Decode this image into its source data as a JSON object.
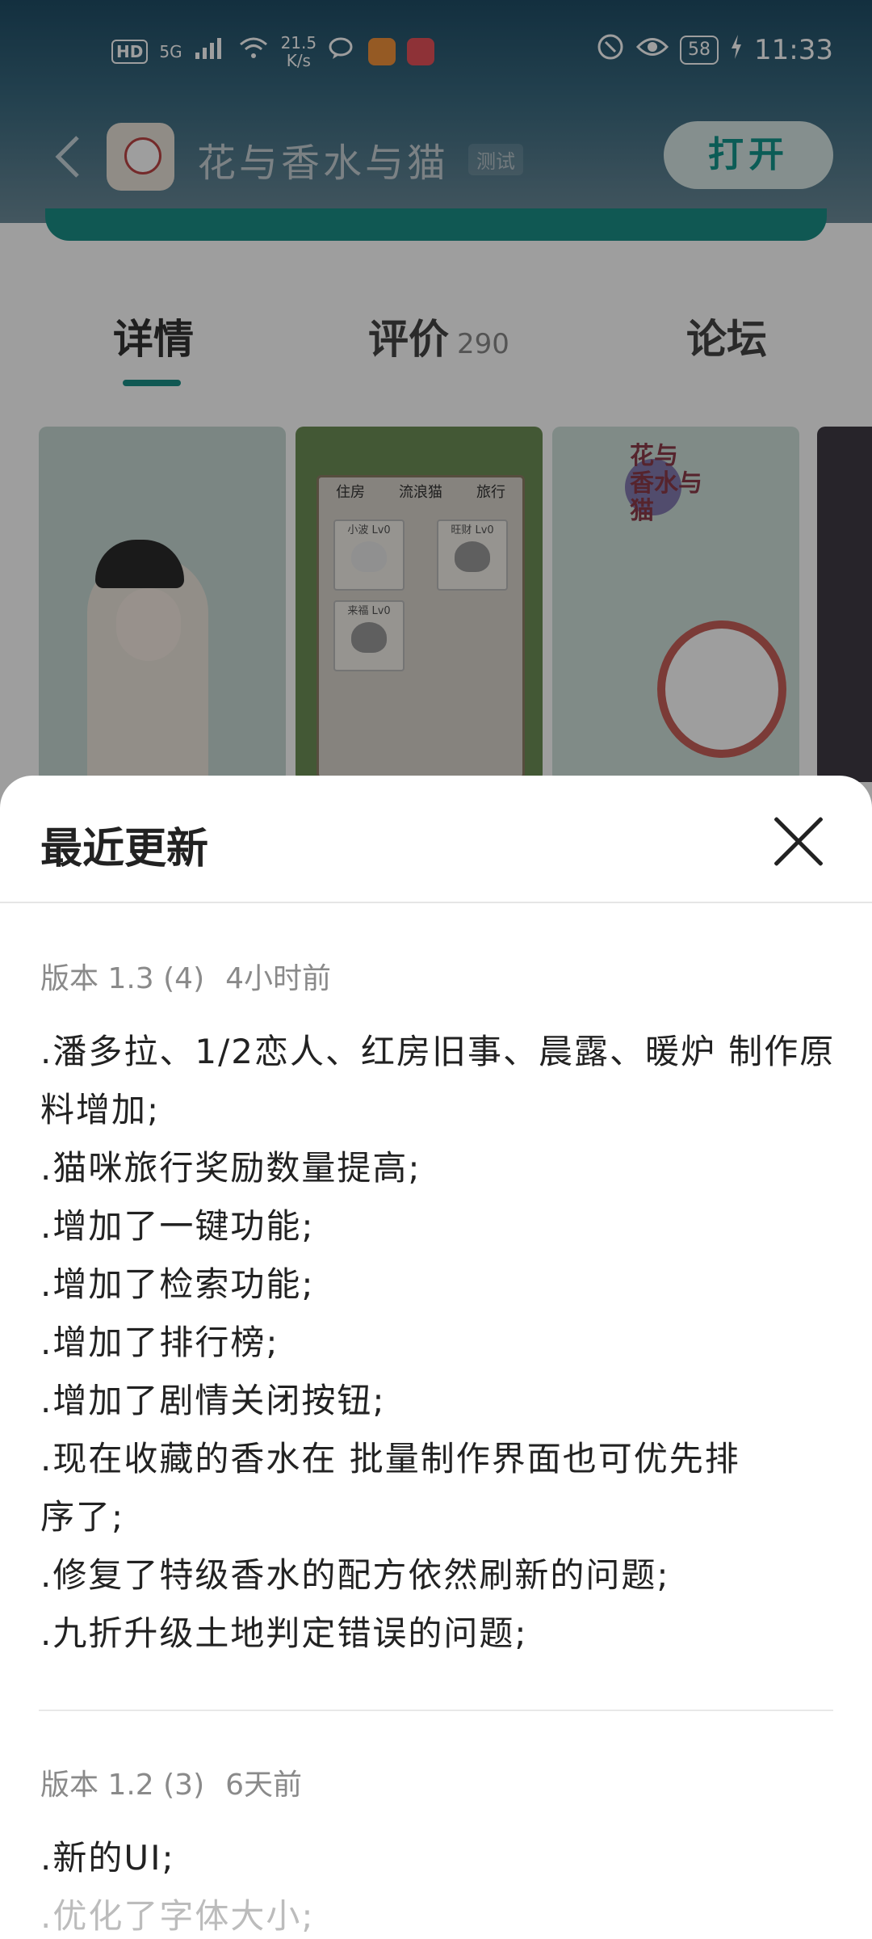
{
  "status_bar": {
    "hd": "HD",
    "network": "5G",
    "speed_value": "21.5",
    "speed_unit": "K/s",
    "battery": "58",
    "time": "11:33"
  },
  "app_header": {
    "title": "花与香水与猫",
    "badge": "测试",
    "open_button": "打开"
  },
  "tabs": [
    {
      "label": "详情",
      "count": ""
    },
    {
      "label": "评价",
      "count": "290"
    },
    {
      "label": "论坛",
      "count": ""
    }
  ],
  "screenshots": {
    "shot2_tabs": [
      "住房",
      "流浪猫",
      "旅行"
    ],
    "shot2_cards": [
      "小波 Lv0",
      "旺财 Lv0",
      "来福 Lv0"
    ],
    "shot3_logo": "花与\n香水与\n猫"
  },
  "sheet": {
    "title": "最近更新",
    "versions": [
      {
        "version": "版本 1.3 (4)",
        "time": "4小时前",
        "notes": [
          ".潘多拉、1/2恋人、红房旧事、晨露、暖炉 制作原",
          "料增加;",
          ".猫咪旅行奖励数量提高;",
          ".增加了一键功能;",
          ".增加了检索功能;",
          ".增加了排行榜;",
          ".增加了剧情关闭按钮;",
          ".现在收藏的香水在 批量制作界面也可优先排",
          "序了;",
          ".修复了特级香水的配方依然刷新的问题;",
          ".九折升级土地判定错误的问题;"
        ]
      },
      {
        "version": "版本 1.2 (3)",
        "time": "6天前",
        "notes": [
          ".新的UI;",
          ".优化了字体大小;"
        ]
      }
    ]
  },
  "colors": {
    "accent": "#1b8f86",
    "open_button_bg": "#d7e7e6"
  }
}
